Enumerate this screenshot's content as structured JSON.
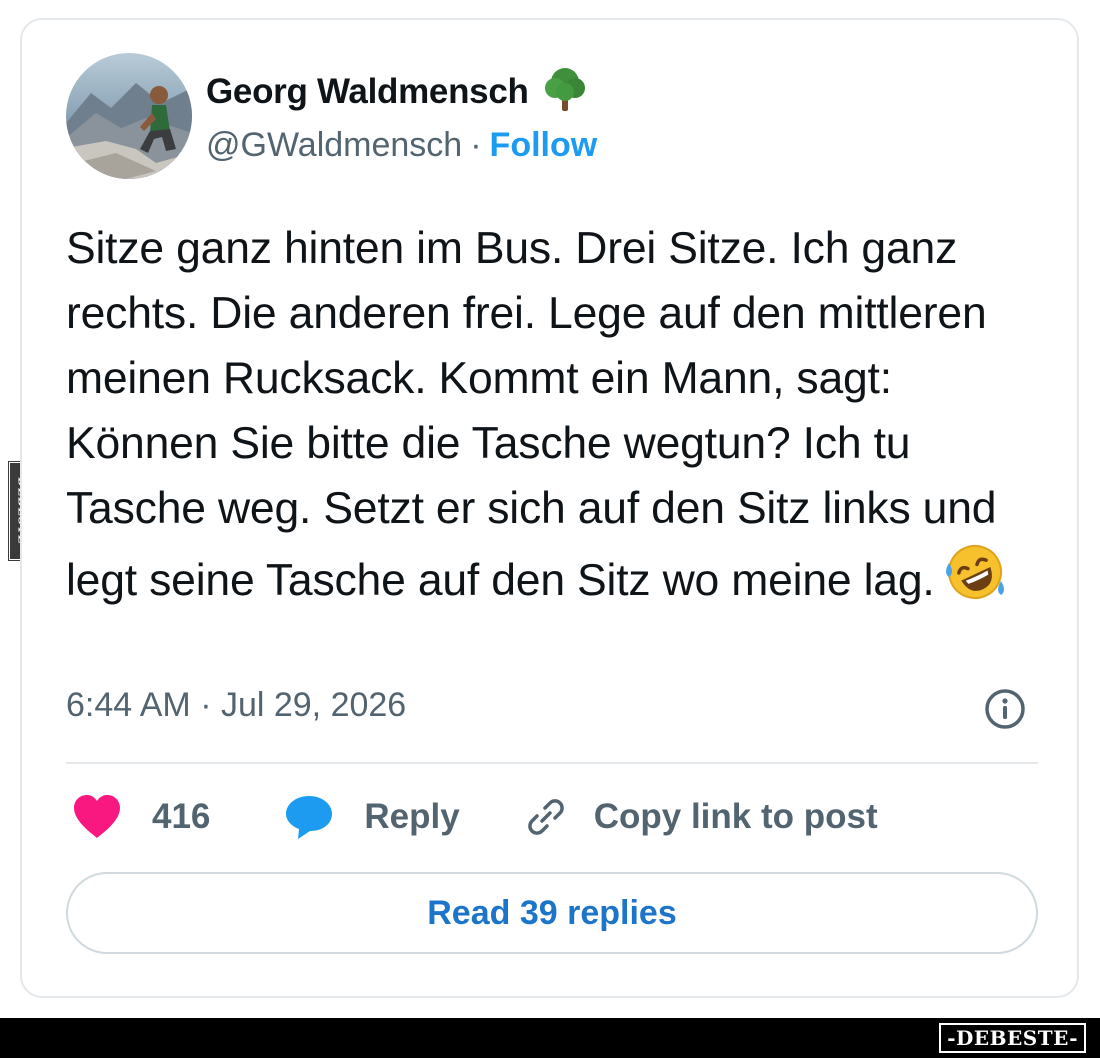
{
  "author": {
    "name": "Georg Waldmensch",
    "name_emoji": "tree-icon",
    "handle": "@GWaldmensch",
    "separator": "·",
    "follow_label": "Follow"
  },
  "tweet": {
    "text": "Sitze ganz hinten im Bus. Drei Sitze. Ich ganz rechts. Die anderen frei. Lege auf den mittleren meinen Rucksack. Kommt ein Mann, sagt: Können Sie bitte die Tasche wegtun? Ich tu Tasche weg. Setzt er sich auf den Sitz links und legt seine Tasche auf den Sitz wo meine lag.",
    "emoji": "rolling-on-floor-laughing-icon",
    "timestamp": "6:44 AM · Jul 29, 2026"
  },
  "actions": {
    "like_count": "416",
    "reply_label": "Reply",
    "copy_link_label": "Copy link to post"
  },
  "read_replies_label": "Read 39 replies",
  "watermarks": {
    "side": "DEBESTE",
    "bottom": "-DEBESTE-"
  },
  "colors": {
    "like": "#f91880",
    "reply": "#1d9bf0",
    "follow": "#1d9bf0",
    "read_replies_text": "#1d75c9",
    "secondary_text": "#536471",
    "primary_text": "#0f1419"
  }
}
